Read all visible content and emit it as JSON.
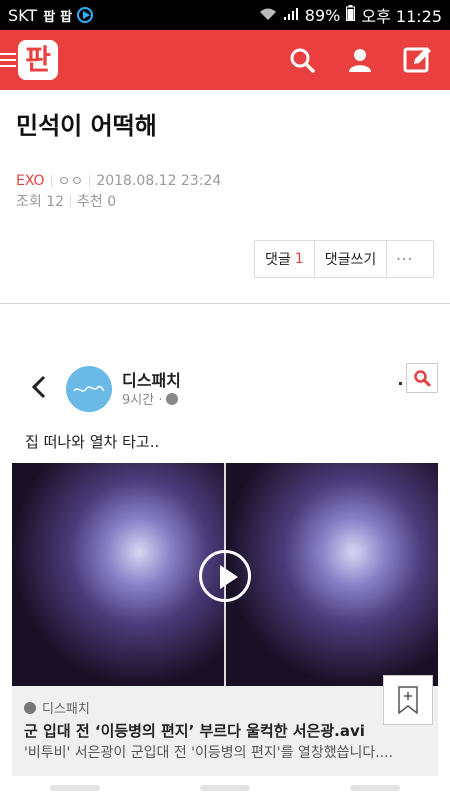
{
  "status_bar": {
    "carrier": "SKT",
    "badge1": "팝",
    "badge2": "팝",
    "battery": "89%",
    "time": "오후 11:25"
  },
  "header": {
    "logo": "판",
    "icons": [
      "menu-icon",
      "search-icon",
      "user-icon",
      "compose-icon"
    ],
    "accent": "#e9403f"
  },
  "article": {
    "title": "민석이 어떡해",
    "category": "EXO",
    "author": "ㅇㅇ",
    "date": "2018.08.12 23:24",
    "views_label": "조회 12",
    "recommend_label": "추천 0"
  },
  "comment_bar": {
    "comments_label": "댓글",
    "comments_count": "1",
    "write_label": "댓글쓰기",
    "more_label": "···"
  },
  "post": {
    "page_name": "디스패치",
    "time_ago": "9시간 ·",
    "caption": "집 떠나와 열차 타고..",
    "link": {
      "source": "디스패치",
      "title": "군 입대 전 ‘이등병의 편지’ 부르다 울컥한 서은광.avi",
      "description": "'비투비' 서은광이 군입대 전 '이등병의 편지'를 열창했씁니다...."
    }
  }
}
